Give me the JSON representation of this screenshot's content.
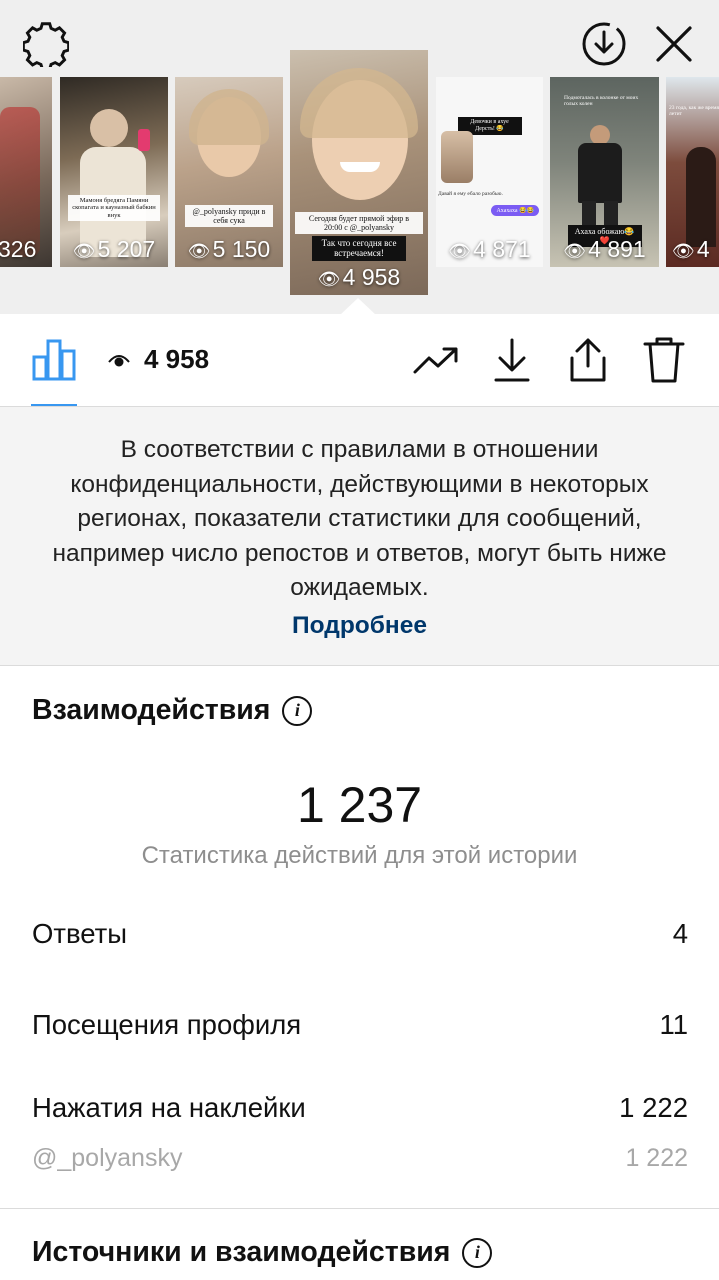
{
  "header": {
    "settings_icon": "gear-icon",
    "download_icon": "download-circle-icon",
    "close_icon": "close-icon"
  },
  "stories": [
    {
      "views": "326",
      "caption": ""
    },
    {
      "views": "5 207",
      "caption": "Мамоня бредяга Памяни скопагата и кауназный бабкин внук"
    },
    {
      "views": "5 150",
      "caption": "@_polyansky приди в себя сука"
    },
    {
      "views": "4 958",
      "caption": "Сегодня будет прямой эфир в 20:00 с @_polyansky",
      "caption2": "Так что сегодня все встречаемся!",
      "selected": true
    },
    {
      "views": "4 871",
      "caption": "Девочки в ахуе Дерсть! 😂",
      "caption2": "Давай я ему ебало разобью.",
      "caption3": "Ахахаха 😂😂"
    },
    {
      "views": "4 891",
      "caption": "Подмоталась в колонке от моих голых колен",
      "caption2": "Ахаха обожаю😂❤️"
    },
    {
      "views": "4",
      "caption": "23 года, как же время летит"
    }
  ],
  "toolbar": {
    "views_count": "4 958",
    "icons": [
      "bar-chart-icon",
      "eye-icon",
      "trending-icon",
      "download-icon",
      "share-icon",
      "trash-icon"
    ]
  },
  "notice": {
    "text": "В соответствии с правилами в отношении конфиденциальности, действующими в некоторых регионах, показатели статистики для сообщений, например число репостов и ответов, могут быть ниже ожидаемых.",
    "link": "Подробнее"
  },
  "interactions": {
    "title": "Взаимодействия",
    "total": "1 237",
    "subtitle": "Статистика действий для этой истории",
    "rows": [
      {
        "label": "Ответы",
        "value": "4"
      },
      {
        "label": "Посещения профиля",
        "value": "11"
      },
      {
        "label": "Нажатия на наклейки",
        "value": "1 222"
      }
    ],
    "sticker": {
      "label": "@_polyansky",
      "value": "1 222"
    }
  },
  "sources": {
    "title": "Источники и взаимодействия"
  },
  "colors": {
    "accent": "#3897f0",
    "link": "#00376b",
    "muted": "#8e8e8e"
  }
}
